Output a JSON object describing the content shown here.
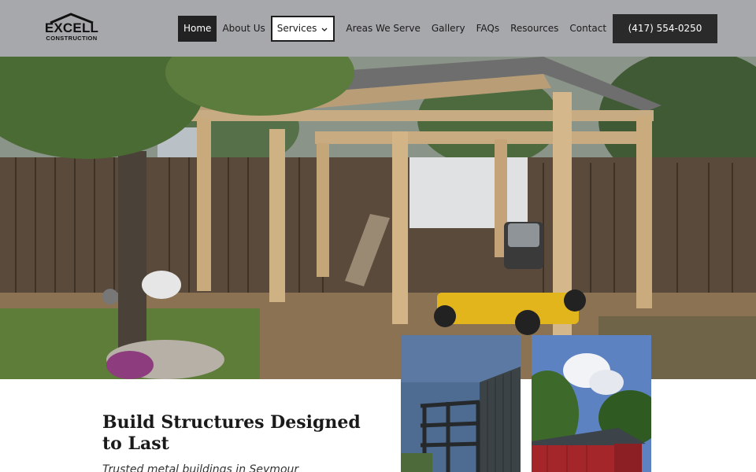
{
  "brand": {
    "name": "EXCELL",
    "subtitle": "CONSTRUCTION"
  },
  "nav": {
    "items": [
      {
        "label": "Home",
        "active": true
      },
      {
        "label": "About Us"
      },
      {
        "label": "Services",
        "dropdown": true
      },
      {
        "label": "Areas We Serve"
      },
      {
        "label": "Gallery"
      },
      {
        "label": "FAQs"
      },
      {
        "label": "Resources"
      },
      {
        "label": "Contact"
      }
    ]
  },
  "cta": {
    "phone": "(417) 554-0250"
  },
  "hero": {
    "headline": "Build Structures Designed to Last",
    "subheadline": "Trusted metal buildings in Seymour"
  },
  "colors": {
    "header_bg": "#a7a8ab",
    "nav_active_bg": "#222222",
    "button_bg": "#2a2a2b",
    "text_dark": "#1a1a1a"
  }
}
